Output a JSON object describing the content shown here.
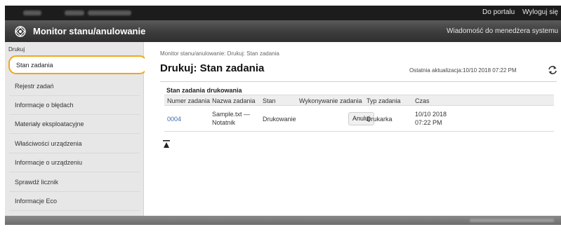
{
  "header": {
    "portal_link": "Do portalu",
    "logout_link": "Wyloguj się"
  },
  "titlebar": {
    "app_title": "Monitor stanu/anulowanie",
    "admin_message": "Wiadomość do menedżera systemu"
  },
  "sidebar": {
    "section": "Drukuj",
    "items": [
      {
        "label": "Stan zadania"
      },
      {
        "label": "Rejestr zadań"
      },
      {
        "label": "Informacje o błędach"
      },
      {
        "label": "Materiały eksploatacyjne"
      },
      {
        "label": "Właściwości urządzenia"
      },
      {
        "label": "Informacje o urządzeniu"
      },
      {
        "label": "Sprawdź licznik"
      },
      {
        "label": "Informacje Eco"
      }
    ]
  },
  "main": {
    "breadcrumb": "Monitor stanu/anulowanie: Drukuj: Stan zadania",
    "title": "Drukuj: Stan zadania",
    "last_update": "Ostatnia aktualizacja:10/10 2018 07:22 PM",
    "section_title": "Stan zadania drukowania",
    "table": {
      "headers": [
        "Numer zadania",
        "Nazwa zadania",
        "Stan",
        "Wykonywanie zadania",
        "Typ zadania",
        "Czas"
      ],
      "rows": [
        {
          "number": "0004",
          "name": "Sample.txt — Notatnik",
          "status": "Drukowanie",
          "action": "Anuluj",
          "type": "Drukarka",
          "time": "10/10 2018 07:22 PM"
        }
      ]
    }
  },
  "colors": {
    "accent_highlight": "#f3a51c",
    "link": "#3a6ab0",
    "titlebar": "#3c3c3c"
  }
}
